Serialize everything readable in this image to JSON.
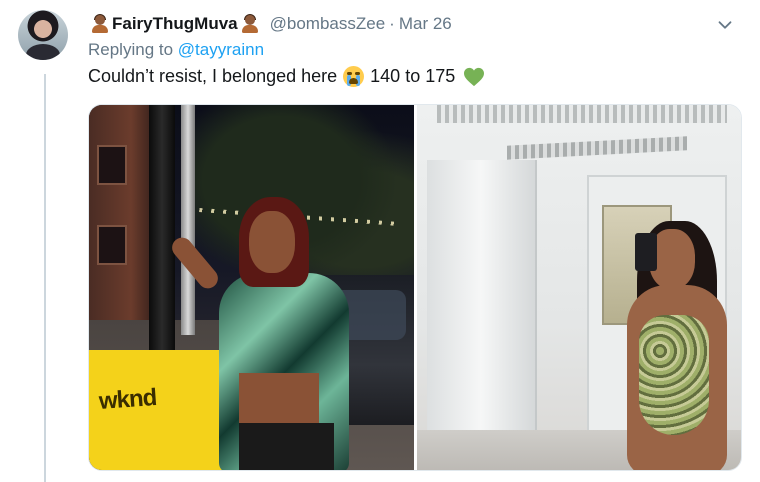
{
  "tweet": {
    "display_name": "FairyThugMuva",
    "handle": "@bombassZee",
    "separator": "·",
    "date": "Mar 26",
    "replying_prefix": "Replying to ",
    "replying_to": "@tayyrainn",
    "text_part1": "Couldn’t resist, I belonged here",
    "text_part2": "140 to 175",
    "emoji_1": "loudly-crying-face",
    "emoji_2": "green-heart",
    "name_emoji": "person-medium-dark-skin-tone"
  },
  "media": {
    "left_photo_sign_text": "wknd"
  },
  "colors": {
    "link": "#1da1f2",
    "secondary_text": "#657786",
    "primary_text": "#14171a",
    "heart": "#77b255",
    "thread_line": "#ccd6dd"
  },
  "icons": {
    "menu": "chevron-down-icon"
  }
}
